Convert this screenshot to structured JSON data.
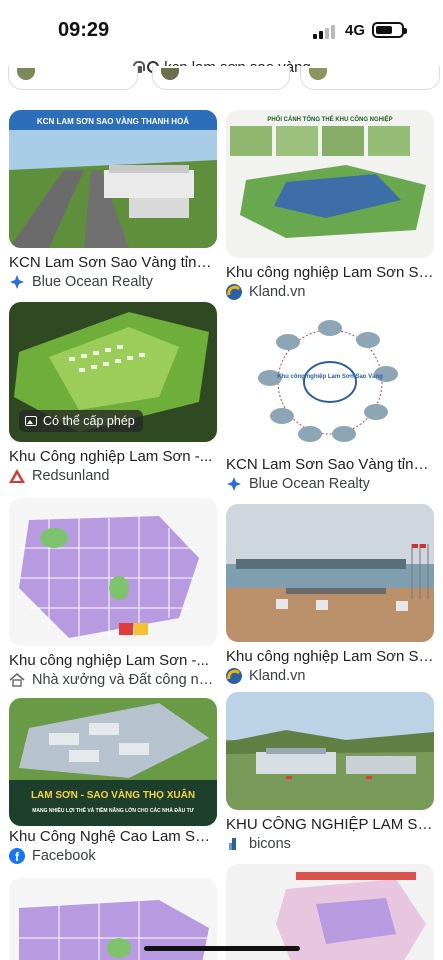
{
  "status_bar": {
    "time": "09:29",
    "network": "4G"
  },
  "url_bar": {
    "query": "kcn lam sơn sao vàng"
  },
  "results": [
    {
      "title": "KCN Lam Sơn Sao Vàng tỉnh...",
      "source": "Blue Ocean Realty",
      "source_icon": "blue-ocean-realty-icon",
      "thumb_text": "KCN LAM SƠN SAO VÀNG THANH HOÁ"
    },
    {
      "title": "Khu công nghiệp Lam Sơn Sa...",
      "source": "Kland.vn",
      "source_icon": "kland-icon",
      "thumb_text": "PHỐI CẢNH TỔNG THỂ KHU CÔNG NGHIỆP"
    },
    {
      "title": "Khu Công nghiệp Lam Sơn -...",
      "source": "Redsunland",
      "source_icon": "redsunland-icon",
      "badge": "Có thể cấp phép"
    },
    {
      "title": "KCN Lam Sơn Sao Vàng tỉnh...",
      "source": "Blue Ocean Realty",
      "source_icon": "blue-ocean-realty-icon",
      "thumb_text": "Khu công nghiệp Lam Sơn Sao Vàng"
    },
    {
      "title": "Khu công nghiệp Lam Sơn -...",
      "source": "Nhà xưởng và Đất công ng...",
      "source_icon": "nhaxuong-icon"
    },
    {
      "title": "Khu công nghiệp Lam Sơn Sa...",
      "source": "Kland.vn",
      "source_icon": "kland-icon"
    },
    {
      "title": "Khu Công Nghệ Cao Lam Sơn...",
      "source": "Facebook",
      "source_icon": "facebook-icon",
      "thumb_text": "LAM SƠN - SAO VÀNG THỌ XUÂN",
      "thumb_sub": "MANG NHIỀU LỢI THẾ VÀ TIỀM NĂNG LỚN CHO CÁC NHÀ ĐẦU TƯ"
    },
    {
      "title": "KHU CÔNG NGHIỆP LAM SƠ...",
      "source": "bicons",
      "source_icon": "bicons-icon"
    }
  ],
  "colors": {
    "blue_ocean": "#2a6fd6",
    "kland": "#2d5fa8",
    "redsun": "#d83a2e",
    "facebook": "#1877f2"
  }
}
